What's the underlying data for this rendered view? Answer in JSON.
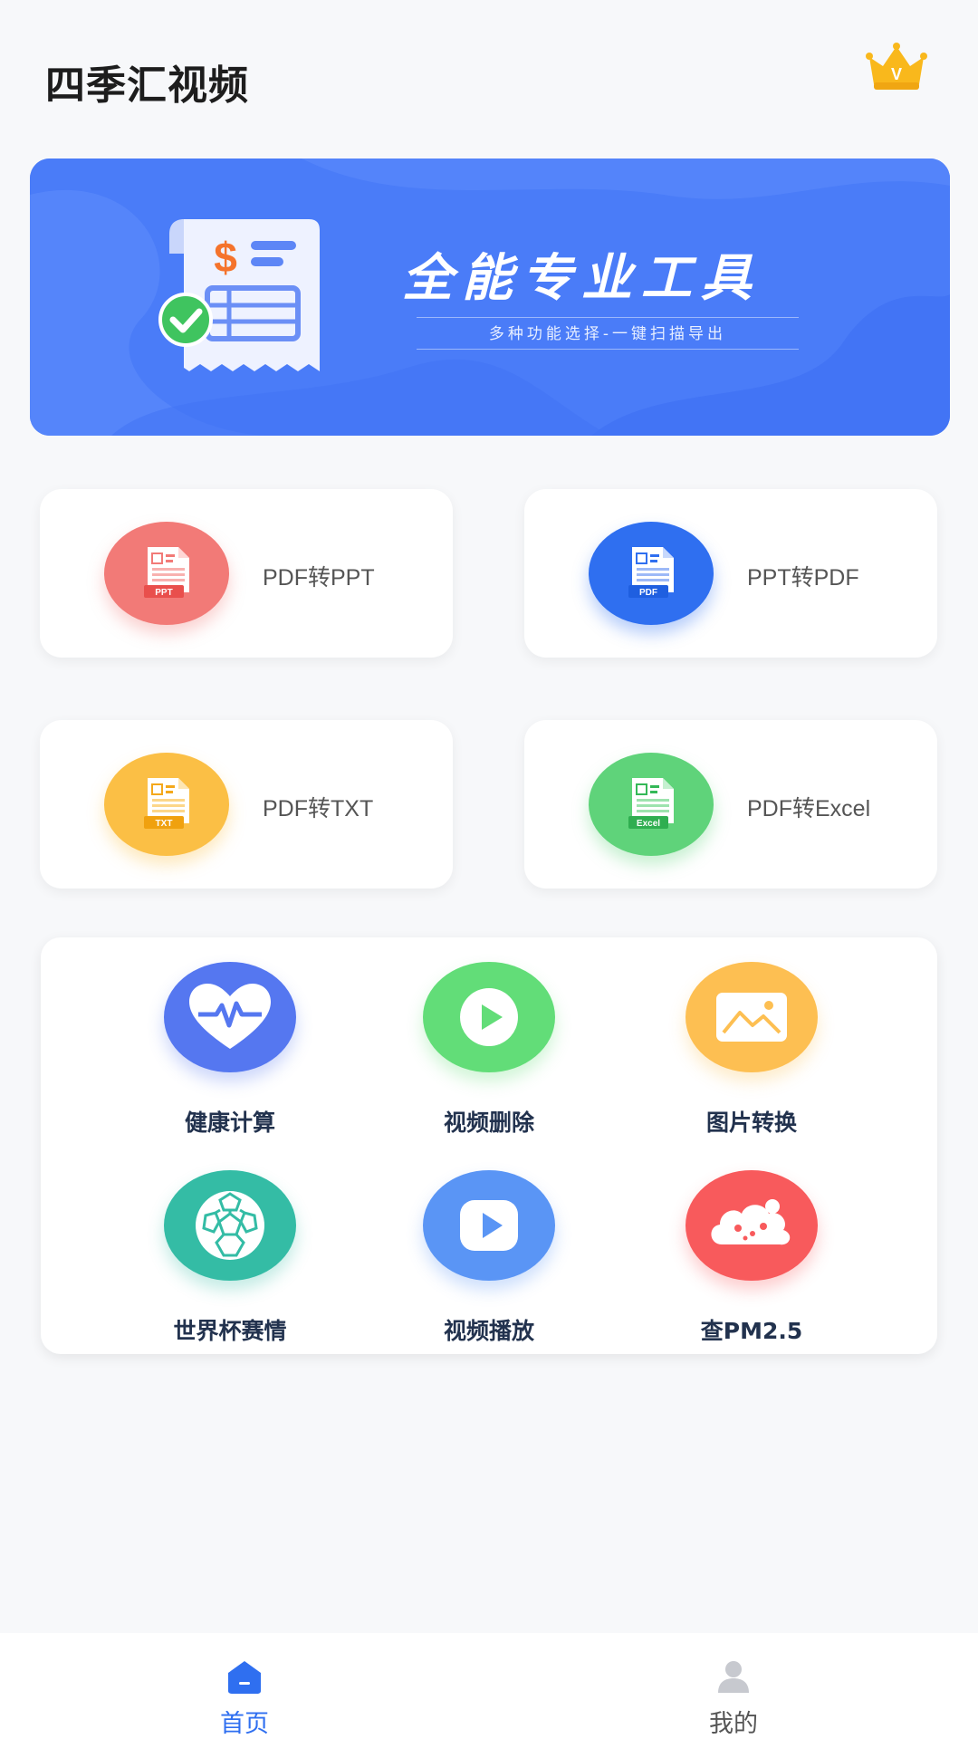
{
  "header": {
    "title": "四季汇视频",
    "vip_icon": "crown-icon",
    "vip_letter": "V"
  },
  "banner": {
    "title": "全能专业工具",
    "subtitle": "多种功能选择-一键扫描导出",
    "icon": "receipt-icon",
    "dollar": "$"
  },
  "convert_cards": [
    {
      "label": "PDF转PPT",
      "badge": "PPT",
      "color": "#f27a77"
    },
    {
      "label": "PPT转PDF",
      "badge": "PDF",
      "color": "#2f6ff0"
    },
    {
      "label": "PDF转TXT",
      "badge": "TXT",
      "color": "#fbbf45"
    },
    {
      "label": "PDF转Excel",
      "badge": "Excel",
      "color": "#5fd37a"
    }
  ],
  "tools": [
    {
      "label": "健康计算",
      "icon": "heart-pulse-icon",
      "color": "#5577f0"
    },
    {
      "label": "视频删除",
      "icon": "play-icon",
      "color": "#62dd78"
    },
    {
      "label": "图片转换",
      "icon": "image-icon",
      "color": "#fdbf52"
    },
    {
      "label": "世界杯赛情",
      "icon": "football-icon",
      "color": "#34bca5"
    },
    {
      "label": "视频播放",
      "icon": "video-play-icon",
      "color": "#5a95f5"
    },
    {
      "label": "查PM2.5",
      "icon": "cloud-icon",
      "color": "#f85a5c"
    }
  ],
  "bottom_nav": {
    "items": [
      {
        "label": "首页",
        "icon": "home-icon",
        "active": true
      },
      {
        "label": "我的",
        "icon": "user-icon",
        "active": false
      }
    ],
    "active_color": "#2f6ff0",
    "inactive_color": "#555555"
  }
}
